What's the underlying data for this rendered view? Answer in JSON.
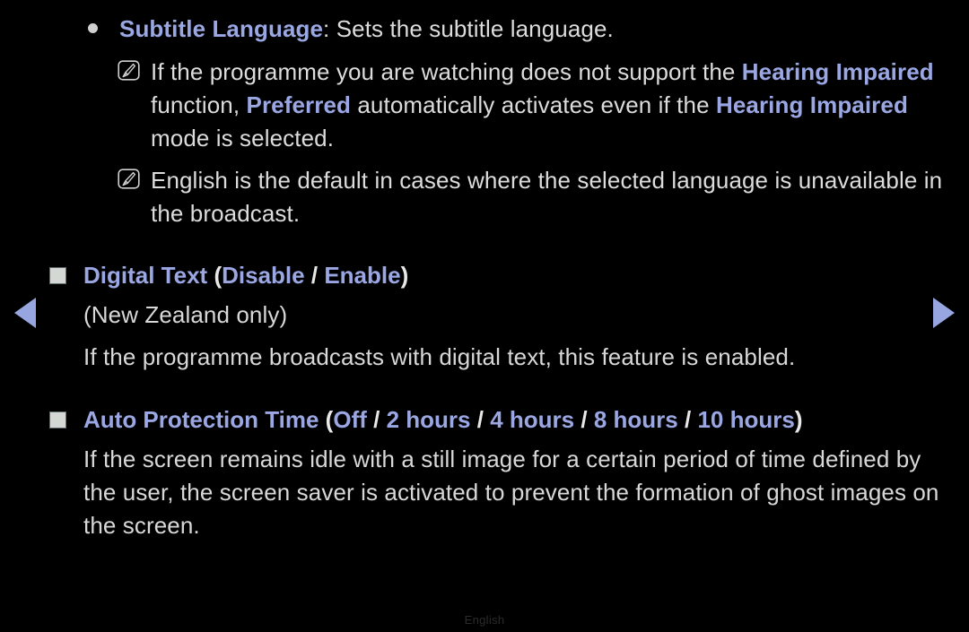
{
  "theme": {
    "background": "#000000",
    "body_text": "#dcdcdc",
    "accent": "#9aa7e3",
    "separator": "#e8e8e8",
    "bullet_dot": "#d0d0d0",
    "bullet_square": "#d5d7d5",
    "arrow": "#97a6e0",
    "footer_text": "#2b2b2b"
  },
  "nav": {
    "prev_icon": "triangle-left-icon",
    "next_icon": "triangle-right-icon"
  },
  "icons": {
    "note": "note-pen-icon",
    "bullet_dot": "bullet-dot-icon",
    "bullet_square": "bullet-square-icon"
  },
  "sections": {
    "subtitle_language": {
      "term": "Subtitle Language",
      "colon": ":",
      "description": " Sets the subtitle language.",
      "notes": [
        {
          "lines": [
            [
              {
                "t": "If the programme you are watching does not support the ",
                "s": "plain"
              },
              {
                "t": "Hearing Impaired",
                "s": "accent-b"
              }
            ],
            [
              {
                "t": "function, ",
                "s": "plain"
              },
              {
                "t": "Preferred",
                "s": "accent-b"
              },
              {
                "t": " automatically activates even if the ",
                "s": "plain"
              },
              {
                "t": "Hearing Impaired",
                "s": "accent-b"
              }
            ],
            [
              {
                "t": "mode is selected.",
                "s": "plain"
              }
            ]
          ]
        },
        {
          "lines": [
            [
              {
                "t": "English is the default in cases where the selected language is unavailable in",
                "s": "plain"
              }
            ],
            [
              {
                "t": "the broadcast.",
                "s": "plain"
              }
            ]
          ]
        }
      ]
    },
    "digital_text": {
      "title": "Digital Text",
      "options": [
        "Disable",
        "Enable"
      ],
      "option_separator": "/",
      "paren_open": "(",
      "paren_close": ")",
      "subnote": "(New Zealand only)",
      "body": [
        "If the programme broadcasts with digital text, this feature is enabled."
      ]
    },
    "auto_protection_time": {
      "title": "Auto Protection Time",
      "options": [
        "Off",
        "2 hours",
        "4 hours",
        "8 hours",
        "10 hours"
      ],
      "option_separator": "/",
      "paren_open": "(",
      "paren_close": ")",
      "body": [
        "If the screen remains idle with a still image for a certain period of time defined by",
        "the user, the screen saver is activated to prevent the formation of ghost images on",
        "the screen."
      ]
    }
  },
  "footer": {
    "language": "English"
  }
}
